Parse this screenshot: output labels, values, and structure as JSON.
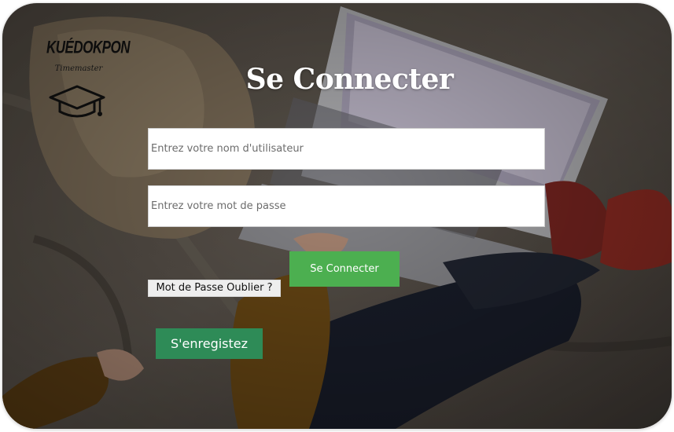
{
  "brand": {
    "name": "KUÉDOKPON",
    "tagline": "Timemaster",
    "icon": "graduation-cap-icon"
  },
  "login": {
    "title": "Se Connecter",
    "username_placeholder": "Entrez votre nom d'utilisateur",
    "password_placeholder": "Entrez votre mot de passe",
    "submit_label": "Se Connecter",
    "forgot_label": "Mot de Passe Oublier ?",
    "register_label": "S'enregistez"
  },
  "colors": {
    "submit_button": "#4caf50",
    "register_button": "#2e8b57",
    "title_text": "#ffffff"
  }
}
